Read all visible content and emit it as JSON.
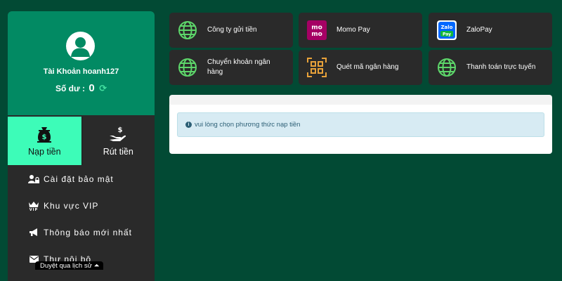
{
  "account": {
    "label": "Tài Khoản hoanh127",
    "balance_label": "Số dư :",
    "balance_value": "0"
  },
  "tabs": [
    {
      "label": "Nạp tiền",
      "icon": "money-bag-icon",
      "active": true
    },
    {
      "label": "Rút tiền",
      "icon": "hand-dollar-icon",
      "active": false
    }
  ],
  "menu": [
    {
      "label": "Cài đặt bảo mật",
      "icon": "user-lock-icon"
    },
    {
      "label": "Khu vực VIP",
      "icon": "vip-crown-icon"
    },
    {
      "label": "Thông báo mới nhất",
      "icon": "megaphone-icon"
    },
    {
      "label": "Thư nội bộ",
      "icon": "envelope-icon"
    }
  ],
  "history_link": "Duyệt qua lịch sử ⏶",
  "methods": [
    {
      "label": "Công ty gửi tiền",
      "icon": "globe-icon"
    },
    {
      "label": "Momo Pay",
      "icon": "momo-logo-icon"
    },
    {
      "label": "ZaloPay",
      "icon": "zalopay-logo-icon"
    },
    {
      "label": "Chuyển khoản ngân hàng",
      "icon": "globe-icon"
    },
    {
      "label": "Quét mã ngân hàng",
      "icon": "qr-scan-icon"
    },
    {
      "label": "Thanh toán trực tuyến",
      "icon": "globe-icon"
    }
  ],
  "alert": {
    "text": "vui lòng chọn phương thức nạp tiền",
    "icon": "info-circle-icon"
  },
  "colors": {
    "background": "#024a34",
    "profile": "#028a63",
    "active_tab": "#3dfcb8",
    "panel": "#2a2a2a",
    "globe": "#5dd66a",
    "momo": "#a50064",
    "zalo": "#0068ff"
  }
}
